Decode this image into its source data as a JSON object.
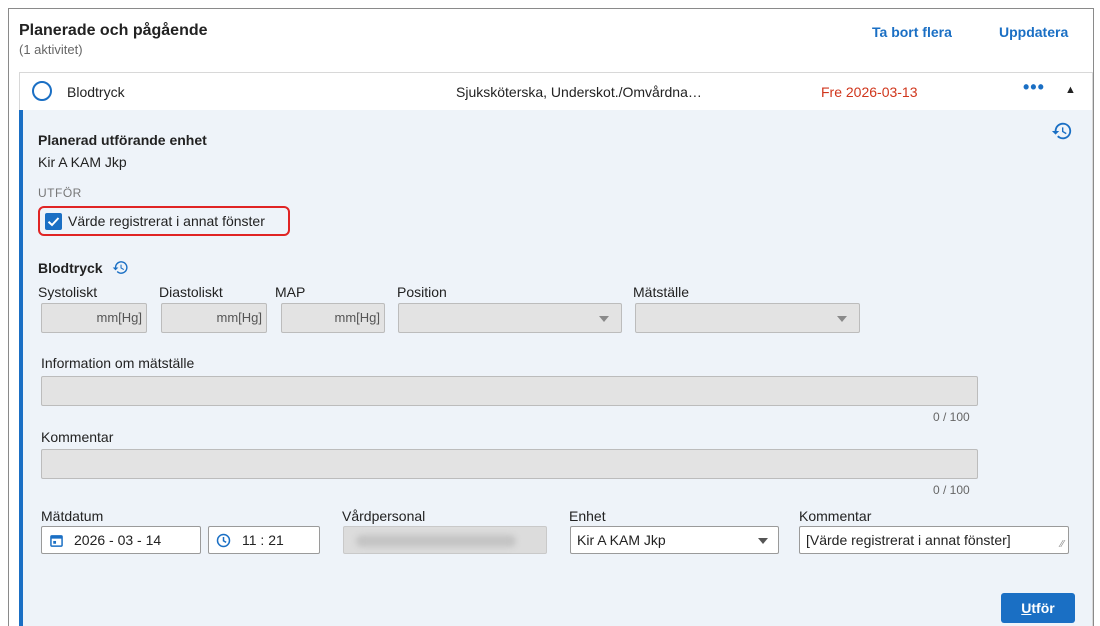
{
  "header": {
    "title": "Planerade och pågående",
    "subtitle": "(1 aktivitet)",
    "remove_many_label": "Ta bort flera",
    "update_label": "Uppdatera"
  },
  "activity": {
    "name": "Blodtryck",
    "roles": "Sjuksköterska, Underskot./Omvårdna…",
    "date": "Fre 2026-03-13",
    "more_label": "•••",
    "date_color": "#d0361c"
  },
  "panel": {
    "planned_unit_label": "Planerad utförande enhet",
    "planned_unit_value": "Kir A KAM Jkp",
    "execute_section": "UTFÖR",
    "checkbox_label": "Värde registrerat i annat fönster",
    "checkbox_checked": true,
    "measure_title": "Blodtryck",
    "fields": {
      "systolic_label": "Systoliskt",
      "systolic_unit": "mm[Hg]",
      "diastolic_label": "Diastoliskt",
      "diastolic_unit": "mm[Hg]",
      "map_label": "MAP",
      "map_unit": "mm[Hg]",
      "position_label": "Position",
      "site_label": "Mätställe"
    },
    "site_info_label": "Information om mätställe",
    "site_info_counter": "0 / 100",
    "comment_label": "Kommentar",
    "comment_counter": "0 / 100",
    "bottom": {
      "date_label": "Mätdatum",
      "date_value": "2026 - 03 - 14",
      "time_value": "11 : 21",
      "staff_label": "Vårdpersonal",
      "unit_label": "Enhet",
      "unit_value": "Kir A KAM Jkp",
      "comment_label": "Kommentar",
      "comment_value": "[Värde registrerat i annat fönster]"
    },
    "submit_label_first": "U",
    "submit_label_rest": "tför"
  },
  "colors": {
    "accent": "#1a6fc4",
    "panel_bg": "#eef3f9",
    "highlight": "#e02424"
  }
}
